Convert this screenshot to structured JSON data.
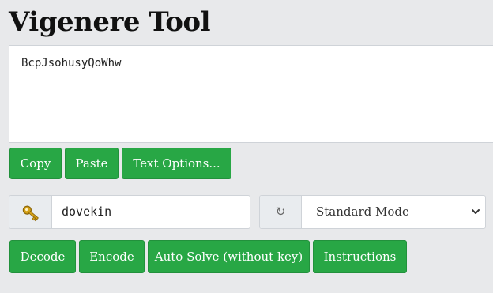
{
  "title": "Vigenere Tool",
  "text_area": {
    "value": "BcpJsohusyQoWhw"
  },
  "text_buttons": {
    "copy": "Copy",
    "paste": "Paste",
    "text_options": "Text Options..."
  },
  "key": {
    "icon": "key-icon",
    "value": "dovekin"
  },
  "mode": {
    "icon": "refresh-icon",
    "selected": "Standard Mode",
    "dropdown_icon": "chevron-down-icon"
  },
  "actions": {
    "decode": "Decode",
    "encode": "Encode",
    "auto_solve": "Auto Solve (without key)",
    "instructions": "Instructions"
  },
  "colors": {
    "button_green": "#28a745",
    "page_background": "#e8e9eb",
    "key_gold": "#d4a017"
  }
}
